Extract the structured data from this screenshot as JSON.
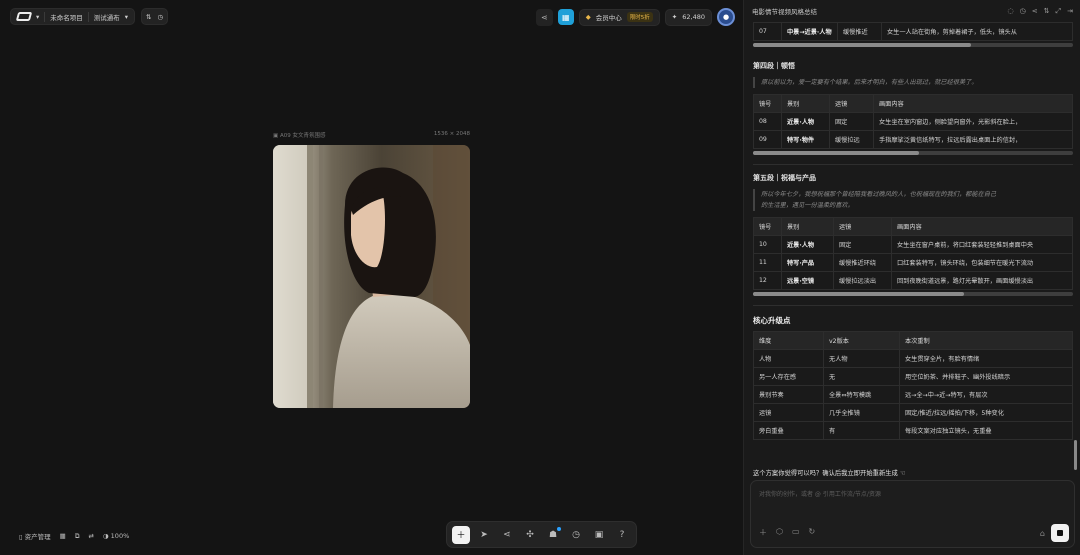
{
  "topbar": {
    "project": "未命名项目",
    "workflow": "测试通布",
    "member_center": "会员中心",
    "member_badge": "限时5折",
    "credits": "62,480"
  },
  "canvas": {
    "image_label": "A09 女文青氛围感",
    "image_size": "1536 × 2048",
    "zoom": "100%",
    "asset_manager": "资产管理"
  },
  "panel": {
    "title": "电影情节视频风格总结",
    "section4": {
      "title": "第四段｜顿悟",
      "quote": "原以前以为，爱一定要有个结果。后来才明白，有些人出现过，就已经很美了。",
      "headers": [
        "镜号",
        "景别",
        "运镜",
        "画面内容"
      ],
      "rows": [
        [
          "08",
          "近景·人物",
          "固定",
          "女生坐在室内窗边，侧脸望向窗外，光影斜在脸上，"
        ],
        [
          "09",
          "特写·物件",
          "缓慢拉远",
          "手指摩挲泛黄信纸特写，拉远后露出桌面上的信封，"
        ]
      ]
    },
    "prev_row": [
      "07",
      "中景→近景·人物",
      "缓慢推近",
      "女生一人站在街角，剪掉着裙子，低头，镜头从"
    ],
    "section5": {
      "title": "第五段｜祝福与产品",
      "quote1": "所以今年七夕，我想祝福那个曾经陪我看过晚风的人，也祝福现在的我们，都能在自己",
      "quote2": "的生活里，遇见一份温柔的喜欢。",
      "headers": [
        "镜号",
        "景别",
        "运镜",
        "画面内容"
      ],
      "rows": [
        [
          "10",
          "近景·人物",
          "固定",
          "女生坐在窗户桌前，将口红套装轻轻推到桌面中央"
        ],
        [
          "11",
          "特写·产品",
          "缓慢推近环绕",
          "口红套装特写，镜头环绕，包装细节在暖光下流动"
        ],
        [
          "12",
          "远景·空镜",
          "缓慢拉远淡出",
          "回到夜晚街道远景，路灯光晕散开，画面缓慢淡出"
        ]
      ]
    },
    "upgrade": {
      "title": "核心升级点",
      "headers": [
        "维度",
        "v2版本",
        "本次重制"
      ],
      "rows": [
        [
          "人物",
          "无人物",
          "女生贯穿全片，有脸有情绪"
        ],
        [
          "另一人存在感",
          "无",
          "用空位奶茶、并排鞋子、幽外投线暗示"
        ],
        [
          "景别节奏",
          "全景⇔特写模跳",
          "远→全→中→近→特写，有层次"
        ],
        [
          "运镜",
          "几乎全推镜",
          "固定/推近/拉远/摇拍/下移，5种变化"
        ],
        [
          "旁白重叠",
          "有",
          "每段文案对应独立镜头，无重叠"
        ]
      ]
    },
    "question": "这个方案你觉得可以吗？确认后我立即开始重新生成",
    "input_placeholder": "对我你的创作，或者 @ 引用工作流/节点/资源"
  }
}
